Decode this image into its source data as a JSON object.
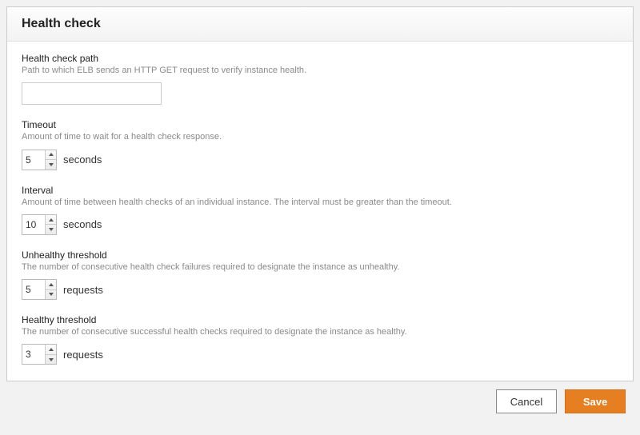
{
  "header": {
    "title": "Health check"
  },
  "fields": {
    "path": {
      "label": "Health check path",
      "desc": "Path to which ELB sends an HTTP GET request to verify instance health.",
      "value": ""
    },
    "timeout": {
      "label": "Timeout",
      "desc": "Amount of time to wait for a health check response.",
      "value": "5",
      "unit": "seconds"
    },
    "interval": {
      "label": "Interval",
      "desc": "Amount of time between health checks of an individual instance. The interval must be greater than the timeout.",
      "value": "10",
      "unit": "seconds"
    },
    "unhealthy": {
      "label": "Unhealthy threshold",
      "desc": "The number of consecutive health check failures required to designate the instance as unhealthy.",
      "value": "5",
      "unit": "requests"
    },
    "healthy": {
      "label": "Healthy threshold",
      "desc": "The number of consecutive successful health checks required to designate the instance as healthy.",
      "value": "3",
      "unit": "requests"
    }
  },
  "actions": {
    "cancel": "Cancel",
    "save": "Save"
  }
}
